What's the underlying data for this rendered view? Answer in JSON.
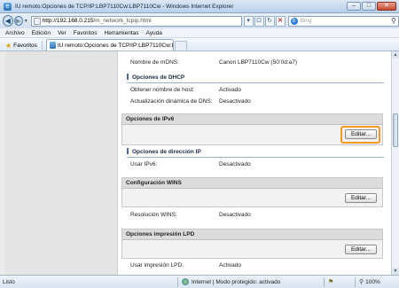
{
  "window": {
    "title": "IU remoto:Opciones de TCP/IP:LBP7110Cw:LBP7110Cw - Windows Internet Explorer"
  },
  "address": {
    "url_main": "http://192.168.0.215",
    "url_rest": "/m_network_tcpip.html",
    "search_placeholder": "Bing"
  },
  "menu": [
    "Archivo",
    "Edición",
    "Ver",
    "Favoritos",
    "Herramientas",
    "Ayuda"
  ],
  "favorites": {
    "label": "Favoritos",
    "tab_label": "IU remoto:Opciones de TCP/IP:LBP7110Cw:LBP7..."
  },
  "page": {
    "mdns_label": "Nombre de mDNS:",
    "mdns_value": "Canon LBP7110Cw (50:0d:a7)",
    "dhcp_title": "Opciones de DHCP",
    "hostname_label": "Obtener nombre de host:",
    "hostname_value": "Activado",
    "dns_update_label": "Actualización dinámica de DNS:",
    "dns_update_value": "Desactivado",
    "ipv6_panel_title": "Opciones de IPv6",
    "edit_label": "Editar...",
    "ip_title": "Opciones de dirección IP",
    "use_ipv6_label": "Usar IPv6:",
    "use_ipv6_value": "Desactivado",
    "wins_panel_title": "Configuración WINS",
    "wins_res_label": "Resolución WINS:",
    "wins_res_value": "Desactivado",
    "lpd_panel_title": "Opciones impresión LPD",
    "lpd_use_label": "Usar impresión LPD:",
    "lpd_use_value": "Activado"
  },
  "status": {
    "left": "Listo",
    "zone": "Internet | Modo protegido: activado",
    "zoom": "100%"
  },
  "colors": {
    "highlight": "#f39a1f",
    "section_bar": "#4a6a9a"
  }
}
